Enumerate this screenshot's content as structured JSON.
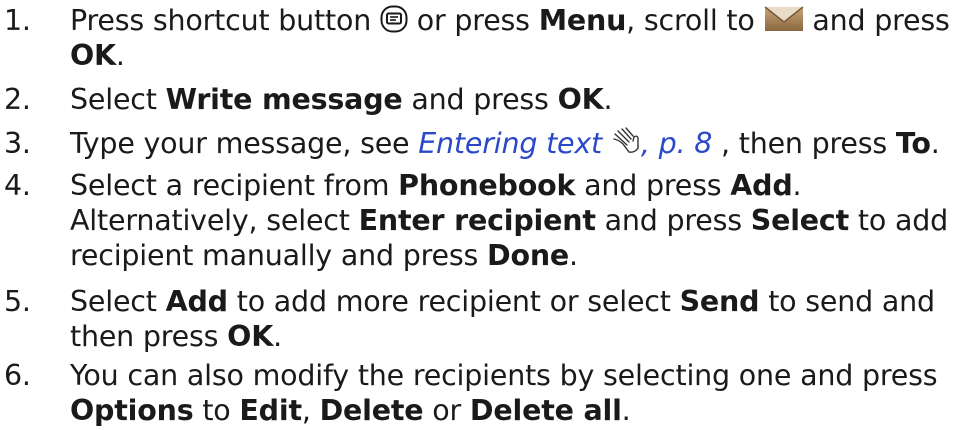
{
  "steps": [
    {
      "number": "1.",
      "t1": "Press shortcut button",
      "t2": "or press",
      "menu": "Menu",
      "t3": ", scroll to",
      "t4": "and press",
      "ok": "OK",
      "t5": "."
    },
    {
      "number": "2.",
      "t1": "Select",
      "write": "Write message",
      "t2": "and press",
      "ok": "OK",
      "t3": "."
    },
    {
      "number": "3.",
      "t1": "Type your message, see",
      "link": "Entering text",
      "page": ", p. 8",
      "t2": ", then press",
      "to": "To",
      "t3": "."
    },
    {
      "number": "4.",
      "t1": "Select a recipient from",
      "phonebook": "Phonebook",
      "t2": "and press",
      "add": "Add",
      "t3": ".",
      "t4": "Alternatively, select",
      "enter": "Enter recipient",
      "t5": "and press",
      "select": "Select",
      "t6": "to add",
      "t7": "recipient manually and press",
      "done": "Done",
      "t8": "."
    },
    {
      "number": "5.",
      "t1": "Select",
      "add": "Add",
      "t2": "to add more recipient or select",
      "send": "Send",
      "t3": "to send and",
      "t4": "then press",
      "ok": "OK",
      "t5": "."
    },
    {
      "number": "6.",
      "t1": "You can also modify the recipients by selecting one and press",
      "options": "Options",
      "t2": "to",
      "edit": "Edit",
      "t3": ",",
      "delete": "Delete",
      "t4": "or",
      "delete_all": "Delete all",
      "t5": "."
    }
  ],
  "icons": {
    "shortcut_button": "sms-key-icon",
    "messages_menu": "envelope-icon",
    "entering_text_reference": "hand-pointer-icon"
  },
  "colors": {
    "text": "#1a1a1a",
    "link": "#2a48c8"
  }
}
